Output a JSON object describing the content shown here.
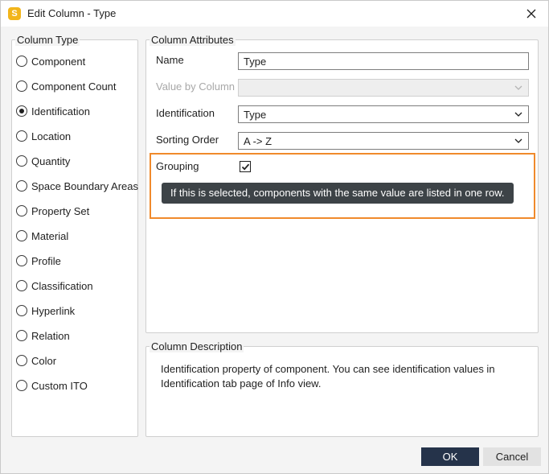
{
  "window": {
    "title": "Edit Column - Type",
    "app_icon_letter": "S",
    "app_icon_color": "#f2b51b"
  },
  "column_type": {
    "legend": "Column Type",
    "options": [
      {
        "label": "Component",
        "checked": false
      },
      {
        "label": "Component Count",
        "checked": false
      },
      {
        "label": "Identification",
        "checked": true
      },
      {
        "label": "Location",
        "checked": false
      },
      {
        "label": "Quantity",
        "checked": false
      },
      {
        "label": "Space Boundary Areas",
        "checked": false
      },
      {
        "label": "Property Set",
        "checked": false
      },
      {
        "label": "Material",
        "checked": false
      },
      {
        "label": "Profile",
        "checked": false
      },
      {
        "label": "Classification",
        "checked": false
      },
      {
        "label": "Hyperlink",
        "checked": false
      },
      {
        "label": "Relation",
        "checked": false
      },
      {
        "label": "Color",
        "checked": false
      },
      {
        "label": "Custom ITO",
        "checked": false
      }
    ]
  },
  "attributes": {
    "legend": "Column Attributes",
    "name_label": "Name",
    "name_value": "Type",
    "value_by_column_label": "Value by Column",
    "value_by_column_value": "",
    "identification_label": "Identification",
    "identification_value": "Type",
    "sorting_order_label": "Sorting Order",
    "sorting_order_value": "A -> Z",
    "grouping_label": "Grouping",
    "grouping_checked": true,
    "grouping_tooltip": "If this is selected, components with the same value are listed in one row.",
    "highlight_color": "#f08a2c"
  },
  "description": {
    "legend": "Column Description",
    "text": "Identification property of component. You can see identification values in Identification tab page of Info view."
  },
  "buttons": {
    "ok_label": "OK",
    "cancel_label": "Cancel",
    "ok_color": "#25334a"
  }
}
